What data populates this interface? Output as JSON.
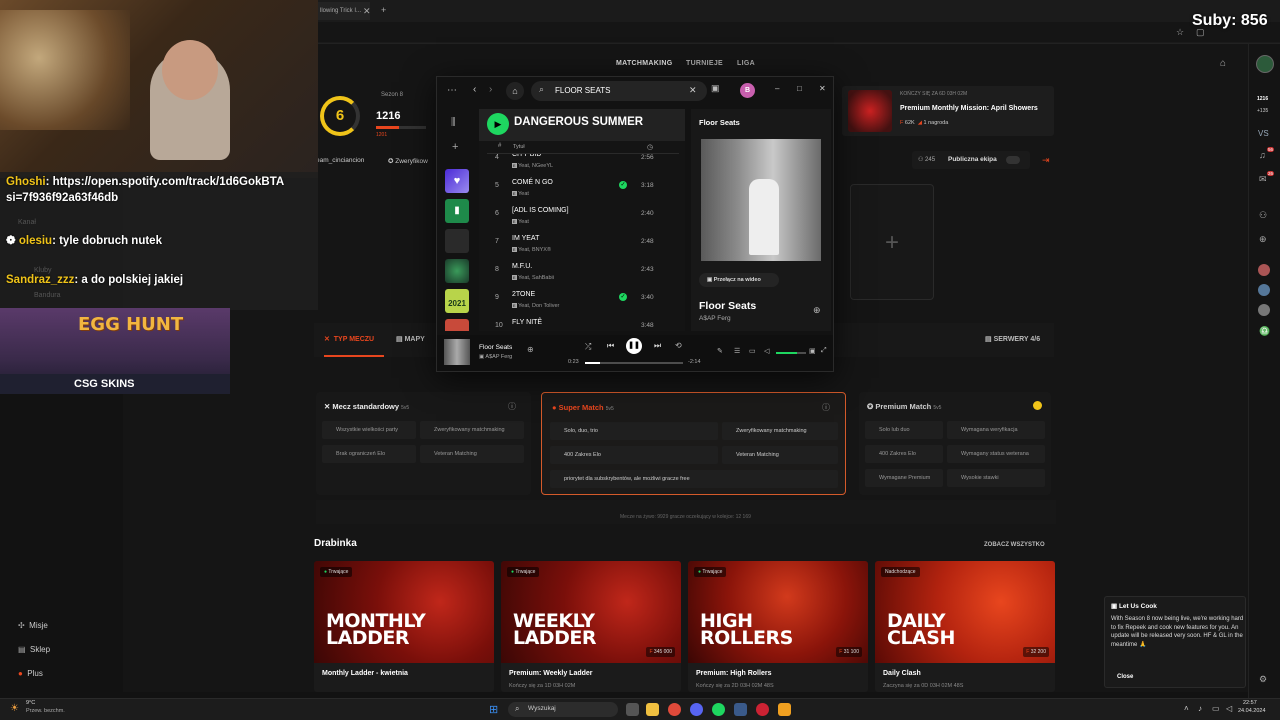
{
  "browser": {
    "tab_label": "llowing Trick I...",
    "subs_counter": "Suby: 856"
  },
  "nav": {
    "items": [
      "MATCHMAKING",
      "TURNIEJE",
      "LIGA"
    ]
  },
  "profile": {
    "level": "6",
    "season": "Sezon 8",
    "elo": "1216",
    "elo_delta": "1201",
    "team": "eam_cinciancion",
    "verified": "Zweryfikow"
  },
  "mission": {
    "ends": "KOŃCZY SIĘ ZA 6D 03H 02M",
    "title": "Premium Monthly Mission: April Showers",
    "reward": "62K",
    "prizes": "1 nagroda"
  },
  "party": {
    "count": "245",
    "label": "Publiczna ekipa"
  },
  "spotify": {
    "search_value": "FLOOR SEATS",
    "avatar_letter": "B",
    "playlist_title": "DANGEROUS SUMMER",
    "col_num": "#",
    "col_title": "Tytuł",
    "tracks": [
      {
        "num": "4",
        "title": "CITY BID",
        "artist": "Yeat, NGeeYL",
        "dur": "2:56",
        "saved": false
      },
      {
        "num": "5",
        "title": "COMÉ N GO",
        "artist": "Yeat",
        "dur": "3:18",
        "saved": true
      },
      {
        "num": "6",
        "title": "[ADL IS COMING]",
        "artist": "Yeat",
        "dur": "2:40",
        "saved": false
      },
      {
        "num": "7",
        "title": "IM YEAT",
        "artist": "Yeat, BNYX®",
        "dur": "2:48",
        "saved": false
      },
      {
        "num": "8",
        "title": "M.F.U.",
        "artist": "Yeat, SahBabii",
        "dur": "2:43",
        "saved": false
      },
      {
        "num": "9",
        "title": "2TONE",
        "artist": "Yeat, Don Toliver",
        "dur": "3:40",
        "saved": true
      },
      {
        "num": "10",
        "title": "FLY NITÊ",
        "artist": "",
        "dur": "3:48",
        "saved": false
      }
    ],
    "np_panel_title": "Floor Seats",
    "video_btn": "Przełącz na wideo",
    "np_song": "Floor Seats",
    "np_artist": "A$AP Ferg",
    "player_song": "Floor Seats",
    "player_artist": "A$AP Ferg",
    "elapsed": "0:23",
    "remaining": "-2:14",
    "progress": 0.15,
    "volume": 0.7,
    "year_tile": "2021"
  },
  "match": {
    "tab_type": "TYP MECZU",
    "tab_maps": "MAPY",
    "servers": "SERWERY 4/6",
    "modes": [
      {
        "title": "Mecz standardowy",
        "size": "5v5",
        "features": [
          "Wszystkie wielkości party",
          "Zweryfikowany matchmaking",
          "Brak ograniczeń Elo",
          "Veteran Matching"
        ]
      },
      {
        "title": "Super Match",
        "size": "5v5",
        "features": [
          "Solo, duo, trio",
          "Zweryfikowany matchmaking",
          "400 Zakres Elo",
          "Veteran Matching",
          "priorytet dla subskrybentów, ale możliwi gracze free"
        ]
      },
      {
        "title": "Premium Match",
        "size": "5v5",
        "features": [
          "Solo lub duo",
          "Wymagana weryfikacja",
          "400 Zakres Elo",
          "Wymagany status weterana",
          "Wymagane Premium",
          "Wysokie stawki"
        ]
      }
    ],
    "queue_stats": "Mecze na żywo: 9929     gracze oczekujący w kolejce: 12 169"
  },
  "ladders": {
    "heading": "Drabinka",
    "see_all": "ZOBACZ WSZYSTKO",
    "items": [
      {
        "badge": "Trwające",
        "art1": "MONTHLY",
        "art2": "LADDER",
        "prize": "",
        "name": "Monthly Ladder - kwietnia",
        "sub": ""
      },
      {
        "badge": "Trwające",
        "art1": "WEEKLY",
        "art2": "LADDER",
        "prize": "345 000",
        "name": "Premium: Weekly Ladder",
        "sub": "Kończy się za 1D 03H 02M"
      },
      {
        "badge": "Trwające",
        "art1": "HIGH",
        "art2": "ROLLERS",
        "prize": "31 100",
        "name": "Premium: High Rollers",
        "sub": "Kończy się za 2D 03H 02M 48S"
      },
      {
        "badge": "Nadchodzące",
        "art1": "DAILY",
        "art2": "CLASH",
        "prize": "32 200",
        "name": "Daily Clash",
        "sub": "Zaczyna się za 0D 03H 02M 48S"
      }
    ]
  },
  "notice": {
    "title": "Let Us Cook",
    "body": "With Season 8 now being live, we're working hard to fix Repeek and cook new features for you. An update will be released very soon. HF & GL in the meantime 🙏",
    "close": "Close"
  },
  "sidebar": {
    "items": [
      "Misje",
      "Sklep",
      "Plus"
    ]
  },
  "chat": {
    "link_user": "Ghoshi",
    "link_text": ": https://open.spotify.com/track/1d6GokBTA",
    "link_text2": "si=7f936f92a63f46db",
    "faded1": "Kanał",
    "msg1_user": "olesiu",
    "msg1_text": ": tyle dobruch nutek",
    "faded2": "Kluby",
    "msg2_user": "Sandraz_zzz",
    "msg2_text": ": a do polskiej jakiej",
    "faded3": "Bandura",
    "ad_title": "EGG HUNT",
    "ad_brand": "CSG SKINS"
  },
  "right_rail": {
    "elo": "1216",
    "num2": "+135",
    "badge1": "56",
    "badge2": "26"
  },
  "taskbar": {
    "weather_temp": "9°C",
    "weather_desc": "Przew. bezchm.",
    "search": "Wyszukaj",
    "time": "22:57",
    "date": "24.04.2024"
  }
}
